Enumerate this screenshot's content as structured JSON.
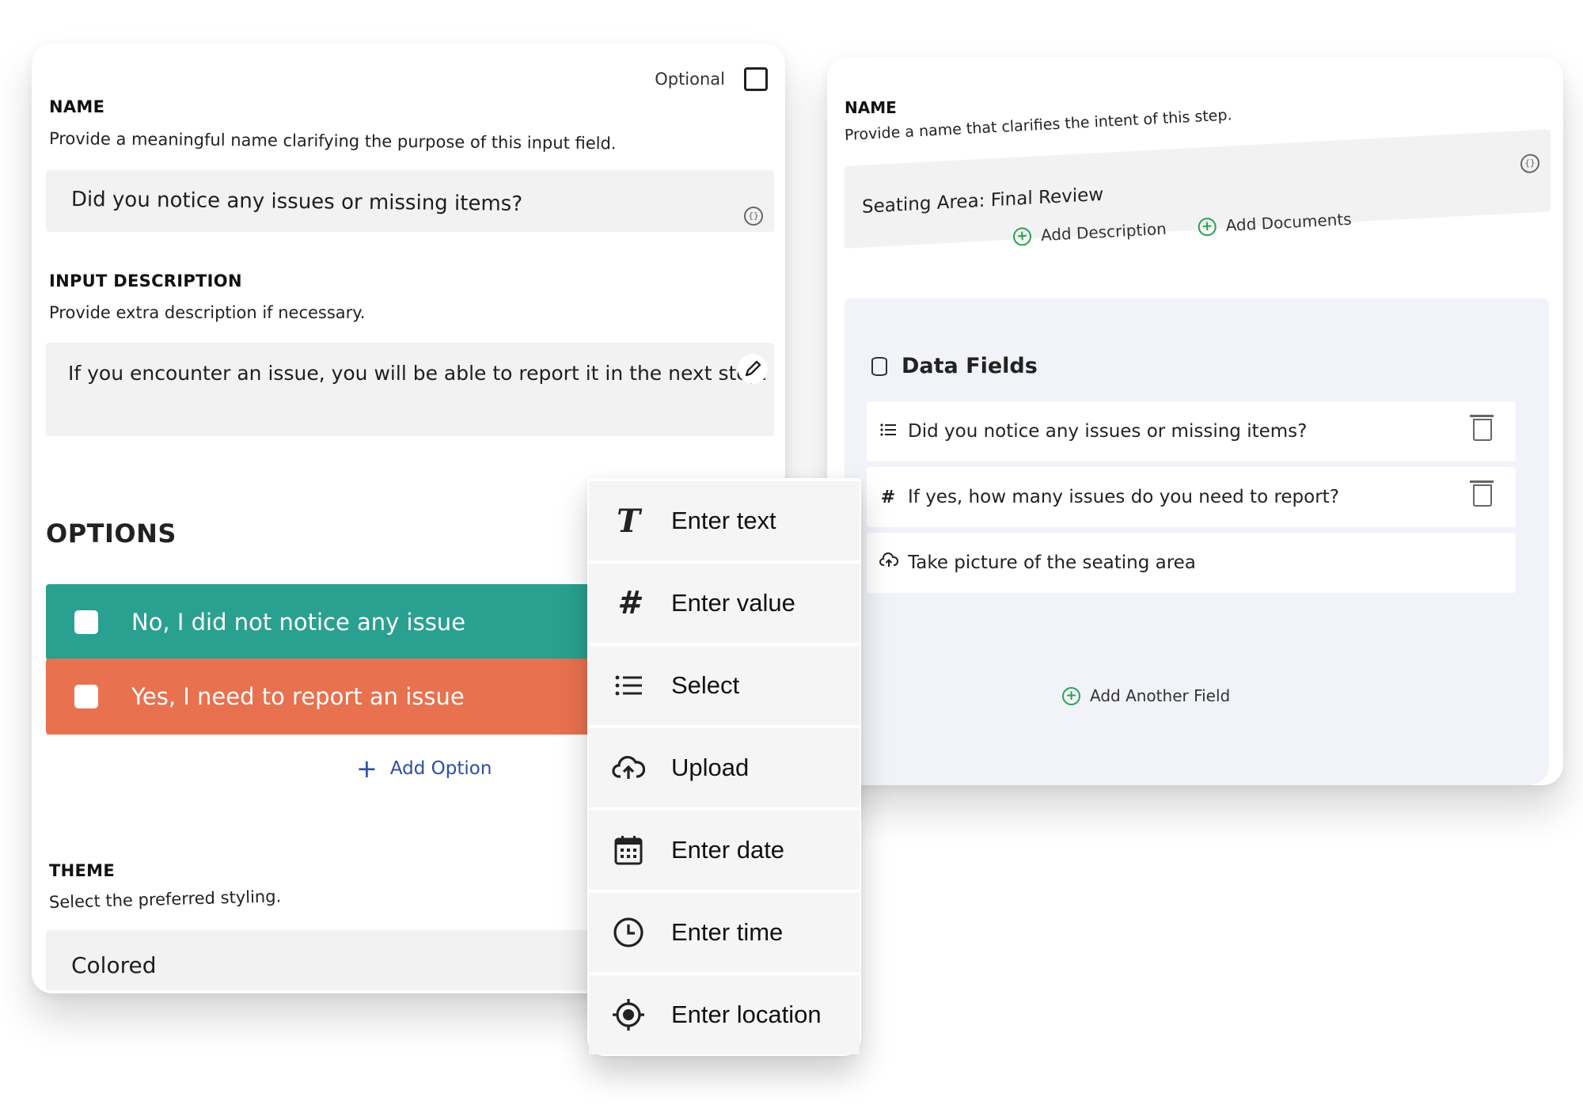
{
  "left_panel": {
    "optional_label": "Optional",
    "name": {
      "title": "NAME",
      "description": "Provide a meaningful name clarifying the purpose of this input field.",
      "value": "Did you notice any issues or missing items?"
    },
    "input_description": {
      "title": "INPUT DESCRIPTION",
      "description": "Provide extra description if necessary.",
      "value": "If you encounter an issue, you will be able to report it in the next step."
    },
    "options": {
      "title": "OPTIONS",
      "items": [
        {
          "label": "No, I did not notice any issue",
          "color": "#2aa090"
        },
        {
          "label": "Yes, I need to report an issue",
          "color": "#e8714f"
        }
      ],
      "add_label": "Add Option"
    },
    "theme": {
      "title": "THEME",
      "description": "Select the preferred styling.",
      "value": "Colored"
    }
  },
  "right_panel": {
    "name": {
      "title": "NAME",
      "description": "Provide a name that clarifies the intent of this step.",
      "value": "Seating Area: Final Review"
    },
    "add_description_label": "Add Description",
    "add_documents_label": "Add Documents",
    "data_fields": {
      "title": "Data Fields",
      "items": [
        {
          "icon": "list-icon",
          "label": "Did you notice any issues or missing items?"
        },
        {
          "icon": "hash-icon",
          "label": "If yes, how many issues do you need to report?"
        },
        {
          "icon": "cloud-upload-icon",
          "label": "Take picture of the seating area"
        }
      ],
      "add_label": "Add Another Field"
    }
  },
  "field_type_menu": {
    "items": [
      {
        "icon": "text-icon",
        "label": "Enter text"
      },
      {
        "icon": "hash-icon",
        "label": "Enter value"
      },
      {
        "icon": "list-icon",
        "label": "Select"
      },
      {
        "icon": "cloud-upload-icon",
        "label": "Upload"
      },
      {
        "icon": "calendar-icon",
        "label": "Enter date"
      },
      {
        "icon": "clock-icon",
        "label": "Enter time"
      },
      {
        "icon": "location-target-icon",
        "label": "Enter location"
      }
    ]
  },
  "colors": {
    "accent_green": "#2aa090",
    "accent_orange": "#e8714f",
    "link_blue": "#2b4ea2",
    "add_green": "#2aa053"
  }
}
